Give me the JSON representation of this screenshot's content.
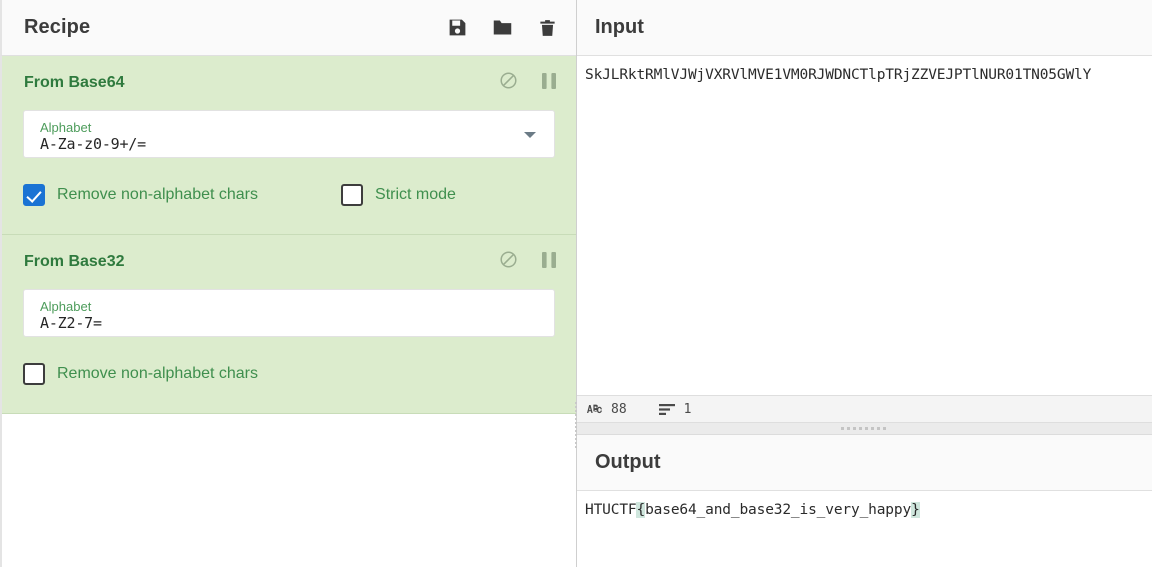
{
  "recipe": {
    "title": "Recipe",
    "controls": [
      {
        "name": "save-recipe",
        "icon": "save-icon",
        "label": "Save recipe"
      },
      {
        "name": "load-recipe",
        "icon": "folder-icon",
        "label": "Load recipe"
      },
      {
        "name": "clear-recipe",
        "icon": "trash-icon",
        "label": "Clear recipe"
      }
    ],
    "operations": [
      {
        "title": "From Base64",
        "disable_label": "Disable operation",
        "pause_label": "Set breakpoint",
        "argument": {
          "label": "Alphabet",
          "value": "A-Za-z0-9+/=",
          "type": "editable-dropdown"
        },
        "checkboxes": [
          {
            "label": "Remove non-alphabet chars",
            "checked": true
          },
          {
            "label": "Strict mode",
            "checked": false
          }
        ]
      },
      {
        "title": "From Base32",
        "disable_label": "Disable operation",
        "pause_label": "Set breakpoint",
        "argument": {
          "label": "Alphabet",
          "value": "A-Z2-7=",
          "type": "text"
        },
        "checkboxes": [
          {
            "label": "Remove non-alphabet chars",
            "checked": false
          }
        ]
      }
    ]
  },
  "input": {
    "title": "Input",
    "value": "SkJLRktRMlVJWjVXRVlMVE1VM0RJWDNCTlpTRjZZVEJPTlNUR01TN05GWlY",
    "status": {
      "length_icon": "abc-icon",
      "length": "88",
      "lines_icon": "lines-icon",
      "lines": "1"
    }
  },
  "output": {
    "title": "Output",
    "prefix": "HTUCTF",
    "open_brace": "{",
    "body": "base64_and_base32_is_very_happy",
    "close_brace": "}",
    "full_value": "HTUCTF{base64_and_base32_is_very_happy}"
  },
  "colors": {
    "operation_bg": "#dceccd",
    "operation_title": "#2f7a3e",
    "checkbox_accent": "#1a73d4",
    "label_green": "#4d9c5b",
    "bracket_highlight": "#cfe6dd"
  }
}
